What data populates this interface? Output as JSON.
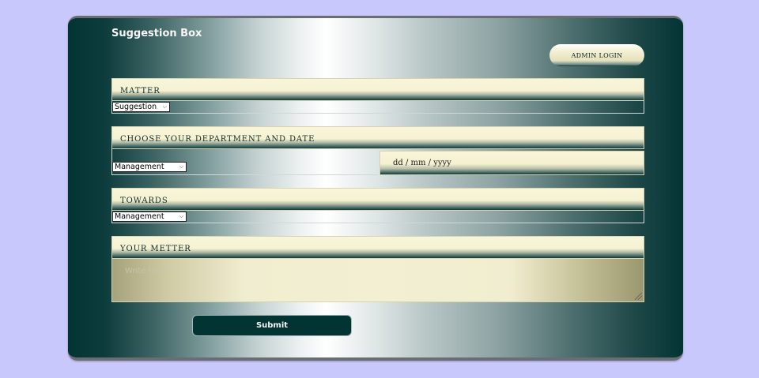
{
  "title": "Suggestion Box",
  "admin_button": "ADMIN LOGIN",
  "matter": {
    "header": "MATTER",
    "selected": "Suggestion"
  },
  "department": {
    "header": "CHOOSE YOUR DEPARTMENT AND DATE",
    "selected": "Management",
    "date_placeholder": "dd / mm / yyyy"
  },
  "towards": {
    "header": "TOWARDS",
    "selected": "Management"
  },
  "your_matter": {
    "header": "YOUR METTER",
    "placeholder": "Write here"
  },
  "submit_label": "Submit",
  "colors": {
    "page_background": "#c8c8fd",
    "card_dark": "#033434",
    "header_cream": "#f6f2d2",
    "submit_bg": "#033434"
  }
}
